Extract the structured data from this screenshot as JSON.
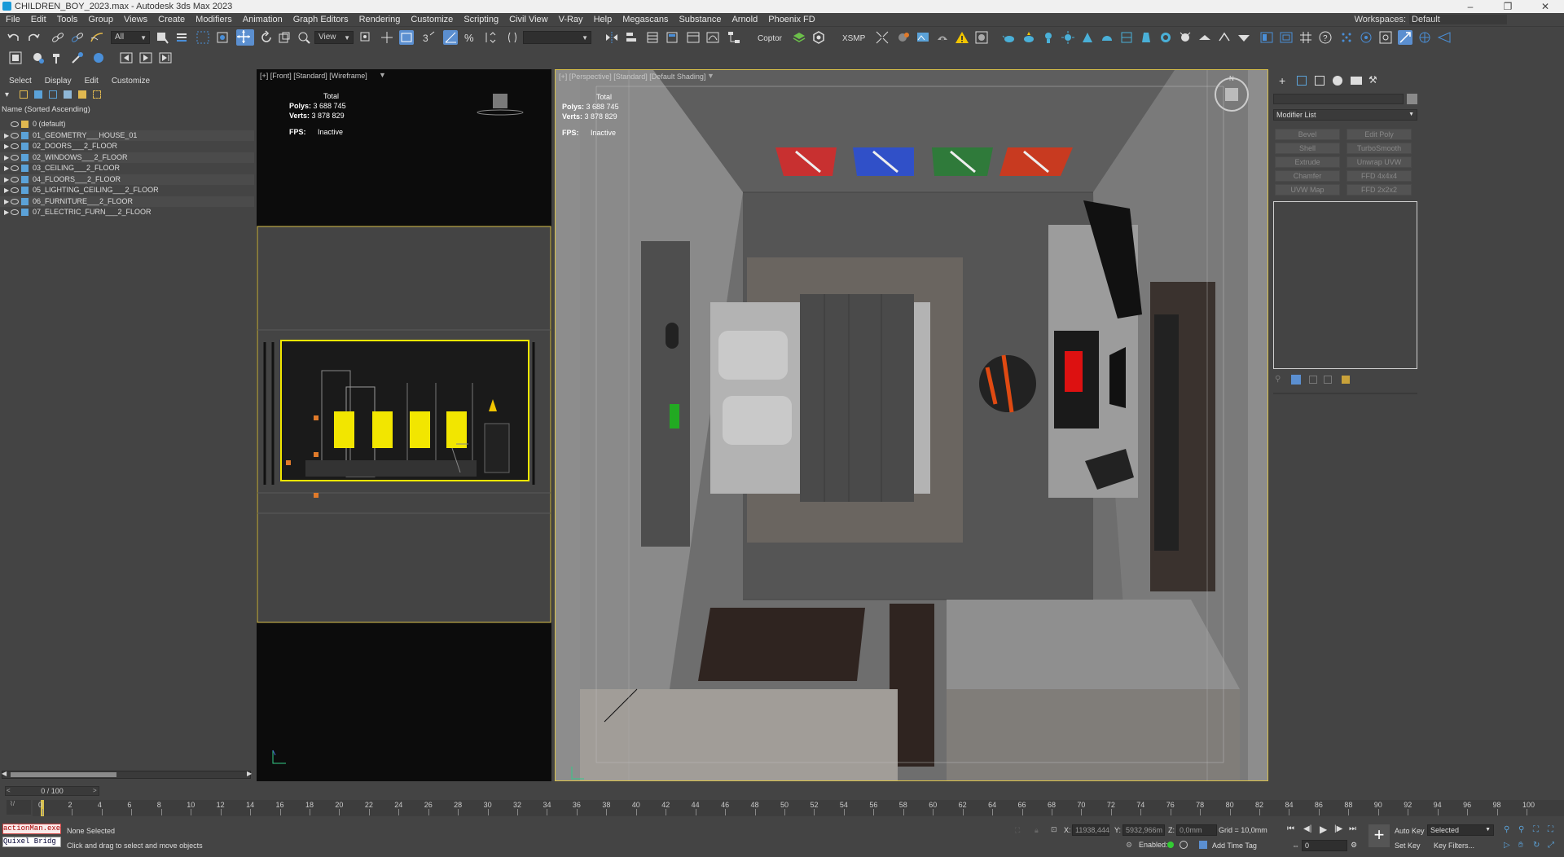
{
  "window": {
    "title": "CHILDREN_BOY_2023.max - Autodesk 3ds Max 2023",
    "minimize": "–",
    "restore": "❐",
    "close": "✕"
  },
  "menu": [
    "File",
    "Edit",
    "Tools",
    "Group",
    "Views",
    "Create",
    "Modifiers",
    "Animation",
    "Graph Editors",
    "Rendering",
    "Customize",
    "Scripting",
    "Civil View",
    "V-Ray",
    "Help",
    "Megascans",
    "Substance",
    "Arnold",
    "Phoenix FD"
  ],
  "workspace": {
    "label": "Workspaces:",
    "value": "Default"
  },
  "toolbar": {
    "selection_filter": "All",
    "ref_coord": "View",
    "named_sel": "",
    "coptor": "Coptor",
    "xsmp": "XSMP"
  },
  "explorer": {
    "tabs": [
      "Select",
      "Display",
      "Edit",
      "Customize"
    ],
    "sort_header": "Name (Sorted Ascending)",
    "layers": [
      "0 (default)",
      "01_GEOMETRY___HOUSE_01",
      "02_DOORS___2_FLOOR",
      "02_WINDOWS___2_FLOOR",
      "03_CEILING___2_FLOOR",
      "04_FLOORS___2_FLOOR",
      "05_LIGHTING_CEILING___2_FLOOR",
      "06_FURNITURE___2_FLOOR",
      "07_ELECTRIC_FURN___2_FLOOR"
    ]
  },
  "viewport_front": {
    "label": "[+] [Front] [Standard] [Wireframe]",
    "total": "Total",
    "polys_label": "Polys:",
    "polys": "3 688 745",
    "verts_label": "Verts:",
    "verts": "3 878 829",
    "fps_label": "FPS:",
    "fps": "Inactive"
  },
  "viewport_persp": {
    "label": "[+] [Perspective] [Standard] [Default Shading]",
    "total": "Total",
    "polys_label": "Polys:",
    "polys": "3 688 745",
    "verts_label": "Verts:",
    "verts": "3 878 829",
    "fps_label": "FPS:",
    "fps": "Inactive"
  },
  "command_panel": {
    "modifier_list": "Modifier List",
    "buttons": [
      "Bevel",
      "Edit Poly",
      "Shell",
      "TurboSmooth",
      "Extrude",
      "Unwrap UVW",
      "Chamfer",
      "FFD 4x4x4",
      "UVW Map",
      "FFD 2x2x2"
    ]
  },
  "timeline": {
    "frame_counter": "0 / 100",
    "ticks": [
      "0",
      "2",
      "4",
      "6",
      "8",
      "10",
      "12",
      "14",
      "16",
      "18",
      "20",
      "22",
      "24",
      "26",
      "28",
      "30",
      "32",
      "34",
      "36",
      "38",
      "40",
      "42",
      "44",
      "46",
      "48",
      "50",
      "52",
      "54",
      "56",
      "58",
      "60",
      "62",
      "64",
      "66",
      "68",
      "70",
      "72",
      "74",
      "76",
      "78",
      "80",
      "82",
      "84",
      "86",
      "88",
      "90",
      "92",
      "94",
      "96",
      "98",
      "100"
    ]
  },
  "status": {
    "maxscript_1": "actionMan.exe",
    "maxscript_2": "Quixel Bridg",
    "selection": "None Selected",
    "prompt": "Click and drag to select and move objects",
    "x_label": "X:",
    "x_value": "11938,444",
    "y_label": "Y:",
    "y_value": "5932,966m",
    "z_label": "Z:",
    "z_value": "0,0mm",
    "grid": "Grid = 10,0mm",
    "enabled": "Enabled:",
    "add_time_tag": "Add Time Tag",
    "auto_key": "Auto Key",
    "set_key": "Set Key",
    "selected": "Selected",
    "key_filters": "Key Filters...",
    "frame": "0"
  },
  "colors": {
    "accent_blue": "#4a8fd8",
    "viewport_frame": "#d8c04a",
    "selection_yellow": "#f2e600",
    "ui_bg": "#444444"
  }
}
